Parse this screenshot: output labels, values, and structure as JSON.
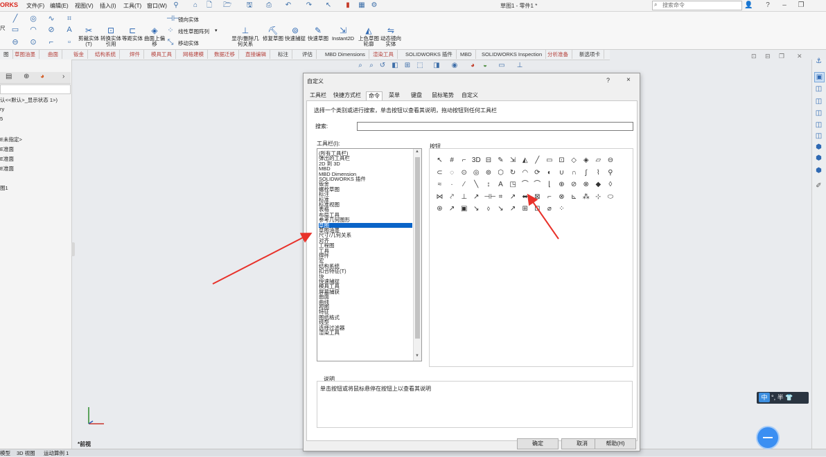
{
  "app": {
    "brand": "ORKS",
    "menu": [
      "文件(F)",
      "编辑(E)",
      "视图(V)",
      "插入(I)",
      "工具(T)",
      "窗口(W)"
    ],
    "doc_title": "草图1 - 零件1 *",
    "search_placeholder": "搜索命令"
  },
  "ribbon": {
    "left_label": "尺",
    "big_buttons": [
      "剪裁实体(T)",
      "转换实体引用",
      "等距实体",
      "曲面上偏移",
      "显示/删除几何关系",
      "修复草图",
      "快速捕捉",
      "快速草图",
      "Instant2D",
      "上色草图轮廓",
      "动态镜向实体"
    ],
    "small_buttons": [
      "镜向实体",
      "线性草图阵列",
      "移动实体"
    ]
  },
  "ribbon_tabs": [
    "图",
    "草图油墨",
    "曲面",
    "钣金",
    "结构系统",
    "焊件",
    "模具工具",
    "网格建模",
    "数据迁移",
    "直接编辑",
    "标注",
    "评估",
    "MBD Dimensions",
    "渲染工具",
    "SOLIDWORKS 插件",
    "MBD",
    "SOLIDWORKS Inspection",
    "分析准备",
    "新选项卡"
  ],
  "left_panel": {
    "lines": [
      "认<<默认>_显示状态 1>)",
      "ry",
      "5",
      "E未指定>",
      "E准面",
      "E准面",
      "E准面",
      "图1"
    ]
  },
  "view_label": "*前视",
  "bottom_tabs": [
    "模型",
    "3D 视图",
    "运动算例 1"
  ],
  "dialog": {
    "title": "自定义",
    "help": "?",
    "close": "×",
    "tabs": [
      "工具栏",
      "快捷方式栏",
      "命令",
      "菜单",
      "键盘",
      "鼠标笔势",
      "自定义"
    ],
    "active_tab": "命令",
    "instruction": "选择一个类别或进行搜索，单击按钮以查看其说明，拖动按钮到任何工具栏",
    "search_label": "搜索:",
    "search_value": "",
    "toolbar_label": "工具栏(I):",
    "buttons_label": "按钮",
    "categories": [
      "(所有工具栏)",
      "弹出的工具栏",
      "2D 到 3D",
      "MBD",
      "MBD Dimension",
      "SOLIDWORKS 插件",
      "钣金",
      "螺栓草图",
      "标注",
      "标准",
      "标准视图",
      "表格",
      "布局工具",
      "参考几何图形",
      "草图",
      "草图油墨",
      "尺寸/几何关系",
      "对齐",
      "工程图",
      "工具",
      "焊件",
      "宏",
      "结构系统",
      "扣合特征(T)",
      "块",
      "快速捕捉",
      "模具工具",
      "屏幕捕获",
      "曲面",
      "曲线",
      "视图",
      "特征",
      "图纸格式",
      "线型",
      "选择过滤器",
      "渲染工具"
    ],
    "selected_category": "草图",
    "description_label": "说明",
    "description_text": "单击按钮或将鼠标悬停在按钮上以查看其说明",
    "ok": "确定",
    "cancel": "取消",
    "help_btn": "帮助(H)",
    "button_icons": [
      "↖",
      "#",
      "⌐",
      "3D",
      "⊟",
      "✎",
      "⇲",
      "◭",
      "╱",
      "▭",
      "⊡",
      "◇",
      "◈",
      "▱",
      "⊖",
      "⊂",
      "◌",
      "⊙",
      "◎",
      "⊚",
      "⬡",
      "↻",
      "◠",
      "⟳",
      "◐",
      "∪",
      "∩",
      "∫",
      "⌇",
      "⚲",
      "≈",
      "·",
      "⁄",
      "╲",
      "↕",
      "A",
      "◳",
      "⌒",
      "⌒",
      "⌊",
      "⊕",
      "⊘",
      "⊗",
      "◆",
      "◊",
      "⋈",
      "⤤",
      "⊥",
      "↗",
      "⊣⊢",
      "⌗",
      "↗",
      "⬌",
      "⊠",
      "⌐",
      "⊗",
      "⊾",
      "⁂",
      "⊹",
      "⬭",
      "⊛",
      "↗",
      "▣",
      "↘",
      "⬨",
      "↘",
      "↗",
      "⊞",
      "⊡",
      "⌀",
      "⁘"
    ]
  },
  "ime": {
    "zh": "中",
    "rest": "°, 半 👕"
  }
}
